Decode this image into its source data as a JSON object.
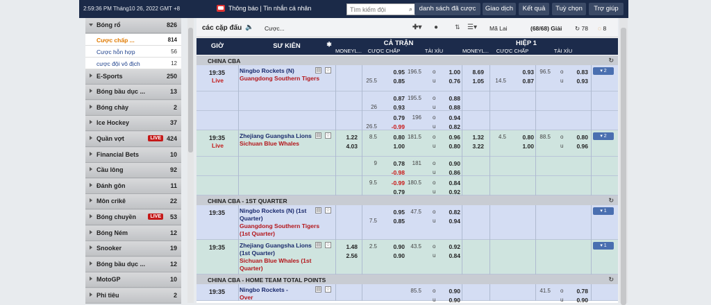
{
  "header": {
    "clock": "2:59:36 PM Tháng10 26, 2022 GMT +8",
    "notice": "Thông báo | Tin nhắn cá nhân",
    "search_placeholder": "Tìm kiếm đội",
    "buttons": [
      "danh sách đã cược",
      "Giao dịch",
      "Kết quả",
      "Tuỳ chọn",
      "Trợ giúp"
    ]
  },
  "sidebar": {
    "items": [
      {
        "label": "Bóng rổ",
        "count": "826",
        "type": "item",
        "open": true
      },
      {
        "label": "Cược chấp ...",
        "count": "814",
        "type": "sub",
        "active": true
      },
      {
        "label": "Cược hỗn hợp",
        "count": "56",
        "type": "sub"
      },
      {
        "label": "cược đội vô địch",
        "count": "12",
        "type": "sub"
      },
      {
        "label": "E-Sports",
        "count": "250",
        "type": "item"
      },
      {
        "label": "Bóng bầu dục ...",
        "count": "13",
        "type": "item"
      },
      {
        "label": "Bóng chày",
        "count": "2",
        "type": "item"
      },
      {
        "label": "Ice Hockey",
        "count": "37",
        "type": "item"
      },
      {
        "label": "Quần vợt",
        "count": "424",
        "type": "item",
        "live": "LIVE"
      },
      {
        "label": "Financial Bets",
        "count": "10",
        "type": "item"
      },
      {
        "label": "Cầu lông",
        "count": "92",
        "type": "item"
      },
      {
        "label": "Đánh gôn",
        "count": "11",
        "type": "item"
      },
      {
        "label": "Môn crikê",
        "count": "22",
        "type": "item"
      },
      {
        "label": "Bóng chuyền",
        "count": "53",
        "type": "item",
        "live": "LIVE"
      },
      {
        "label": "Bóng Ném",
        "count": "12",
        "type": "item"
      },
      {
        "label": "Snooker",
        "count": "19",
        "type": "item"
      },
      {
        "label": "Bóng bầu dục ...",
        "count": "12",
        "type": "item"
      },
      {
        "label": "MotoGP",
        "count": "10",
        "type": "item"
      },
      {
        "label": "Phi tiêu",
        "count": "2",
        "type": "item"
      }
    ]
  },
  "toolbar": {
    "title": "các cặp đấu",
    "filter": "Cược...",
    "mode": "Mã Lai",
    "count": "(68/68) Giải",
    "refresh1": "78",
    "refresh2": "8"
  },
  "columns": {
    "time": "GIỜ",
    "event": "SỰ KIỆN",
    "full": "CẢ TRẬN",
    "half": "HIỆP 1",
    "moneyline": "MONEYL...",
    "handicap": "CƯỢC CHẤP",
    "ou": "TÀI XỈU",
    "moneyline2": "MONEYL...",
    "handicap2": "CƯỢC CHẤP",
    "ou2": "TÀI XỈU"
  },
  "leagues": [
    {
      "name": "CHINA CBA",
      "rows": [
        {
          "time": "19:35",
          "status": "Live",
          "home": "Ningbo Rockets (N)",
          "away": "Guangdong Southern Tigers",
          "color": "blue",
          "h": 38,
          "more": "▾ 2",
          "lines": [
            {
              "ml": "",
              "hc": "",
              "o1": "0.95",
              "ouv": "196.5",
              "uo": "o",
              "o2": "1.00",
              "hml": "8.69",
              "hhc": "",
              "ho1": "0.93",
              "houv": "96.5",
              "huo": "o",
              "ho2": "0.83"
            },
            {
              "ml": "",
              "hc": "25.5",
              "o1": "0.85",
              "ouv": "",
              "uo": "u",
              "o2": "0.76",
              "hml": "1.05",
              "hhc": "14.5",
              "ho1": "0.87",
              "houv": "",
              "huo": "u",
              "ho2": "0.93"
            }
          ]
        },
        {
          "color": "blue",
          "h": 28,
          "lines": [
            {
              "o1": "0.87",
              "ouv": "195.5",
              "uo": "o",
              "o2": "0.88"
            },
            {
              "hc": "26",
              "o1": "0.93",
              "uo": "u",
              "o2": "0.88"
            }
          ]
        },
        {
          "color": "blue",
          "h": 28,
          "lines": [
            {
              "o1": "0.79",
              "ouv": "196",
              "uo": "o",
              "o2": "0.94"
            },
            {
              "hc": "26.5",
              "o1": "-0.99",
              "uo": "u",
              "o2": "0.82",
              "neg1": true
            }
          ]
        },
        {
          "time": "19:35",
          "status": "Live",
          "home": "Zhejiang Guangsha Lions",
          "away": "Sichuan Blue Whales",
          "color": "green",
          "h": 38,
          "more": "▾ 2",
          "lines": [
            {
              "ml": "1.22",
              "hc": "8.5",
              "o1": "0.80",
              "ouv": "181.5",
              "uo": "o",
              "o2": "0.96",
              "hml": "1.32",
              "hhc": "4.5",
              "ho1": "0.80",
              "houv": "88.5",
              "huo": "o",
              "ho2": "0.80"
            },
            {
              "ml": "4.03",
              "hc": "",
              "o1": "1.00",
              "ouv": "",
              "uo": "u",
              "o2": "0.80",
              "hml": "3.22",
              "hhc": "",
              "ho1": "1.00",
              "houv": "",
              "huo": "u",
              "ho2": "0.96"
            }
          ]
        },
        {
          "color": "green",
          "h": 28,
          "lines": [
            {
              "hc": "9",
              "o1": "0.78",
              "ouv": "181",
              "uo": "o",
              "o2": "0.90"
            },
            {
              "o1": "-0.98",
              "uo": "u",
              "o2": "0.86",
              "neg1": true
            }
          ]
        },
        {
          "color": "green",
          "h": 28,
          "lines": [
            {
              "hc": "9.5",
              "o1": "-0.99",
              "ouv": "180.5",
              "uo": "o",
              "o2": "0.84",
              "neg1": true
            },
            {
              "o1": "0.79",
              "uo": "u",
              "o2": "0.92"
            }
          ]
        }
      ]
    },
    {
      "name": "CHINA CBA - 1ST QUARTER",
      "rows": [
        {
          "time": "19:35",
          "home": "Ningbo Rockets (N) (1st Quarter)",
          "away": "Guangdong Southern Tigers (1st Quarter)",
          "color": "blue",
          "h": 50,
          "more": "▾ 1",
          "lines": [
            {
              "o1": "0.95",
              "ouv": "47.5",
              "uo": "o",
              "o2": "0.82"
            },
            {
              "hc": "7.5",
              "o1": "0.85",
              "uo": "u",
              "o2": "0.94"
            }
          ]
        },
        {
          "time": "19:35",
          "home": "Zhejiang Guangsha Lions (1st Quarter)",
          "away": "Sichuan Blue Whales (1st Quarter)",
          "color": "green",
          "h": 50,
          "more": "▾ 1",
          "lines": [
            {
              "ml": "1.48",
              "hc": "2.5",
              "o1": "0.90",
              "ouv": "43.5",
              "uo": "o",
              "o2": "0.92"
            },
            {
              "ml": "2.56",
              "o1": "0.90",
              "uo": "u",
              "o2": "0.84"
            }
          ]
        }
      ]
    },
    {
      "name": "CHINA CBA - HOME TEAM TOTAL POINTS",
      "rows": [
        {
          "time": "19:35",
          "home": "Ningbo Rockets -",
          "away": "Over",
          "color": "blue",
          "h": 24,
          "lines": [
            {
              "o1": "",
              "ouv": "85.5",
              "uo": "o",
              "o2": "0.90",
              "houv": "41.5",
              "huo": "o",
              "ho2": "0.78"
            },
            {
              "uo": "u",
              "o2": "0.90",
              "huo": "u",
              "ho2": "0.90"
            }
          ]
        }
      ]
    }
  ],
  "colors": {
    "nav": "#1c2b4b",
    "blue_row": "#d4ddf3",
    "green_row": "#cfe4df",
    "live": "#c31d1d"
  }
}
